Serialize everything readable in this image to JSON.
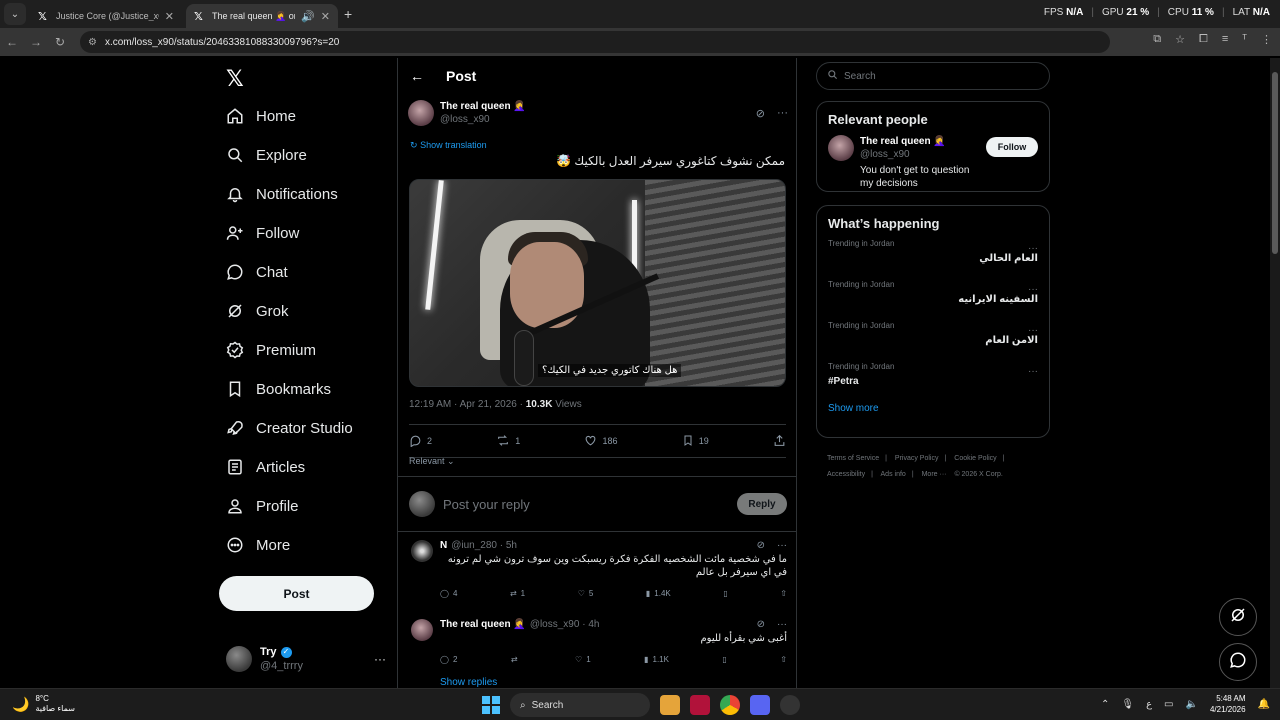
{
  "browser": {
    "tabs": [
      {
        "title": "Justice Core (@Justice_xCore) /",
        "active": false
      },
      {
        "title": "The real queen 🤦‍♀️ on X: \"مـ",
        "active": true
      }
    ],
    "url": "x.com/loss_x90/status/2046338108833009796?s=20",
    "perf": {
      "fps_label": "FPS",
      "fps": "N/A",
      "gpu_label": "GPU",
      "gpu": "21 %",
      "cpu_label": "CPU",
      "cpu": "11 %",
      "lat_label": "LAT",
      "lat": "N/A"
    }
  },
  "nav": {
    "logo": "𝕏",
    "items": [
      {
        "label": "Home",
        "icon": "home-icon"
      },
      {
        "label": "Explore",
        "icon": "search-icon"
      },
      {
        "label": "Notifications",
        "icon": "bell-icon"
      },
      {
        "label": "Follow",
        "icon": "person-plus-icon"
      },
      {
        "label": "Chat",
        "icon": "chat-icon"
      },
      {
        "label": "Grok",
        "icon": "grok-icon"
      },
      {
        "label": "Premium",
        "icon": "premium-icon"
      },
      {
        "label": "Bookmarks",
        "icon": "bookmark-icon"
      },
      {
        "label": "Creator Studio",
        "icon": "rocket-icon"
      },
      {
        "label": "Articles",
        "icon": "article-icon"
      },
      {
        "label": "Profile",
        "icon": "person-icon"
      },
      {
        "label": "More",
        "icon": "more-circle-icon"
      }
    ],
    "post_label": "Post",
    "account": {
      "name": "Try",
      "handle": "@4_trrry",
      "more": "···"
    }
  },
  "post": {
    "header": "Post",
    "author_name": "The real queen 🤦‍♀️",
    "author_handle": "@loss_x90",
    "show_translation": "Show translation",
    "text": "ممكن نشوف كتاغوري سيرفر العدل بالكيك 🤯",
    "subtitle": "هل هناك كاتوري جديد في الكيك؟",
    "time": "12:19 AM · Apr 21, 2026 · ",
    "views_count": "10.3K",
    "views_label": " Views",
    "replies": "2",
    "reposts": "1",
    "likes": "186",
    "bookmarks": "19",
    "relevant": "Relevant ⌄",
    "reply_placeholder": "Post your reply",
    "reply_button": "Reply"
  },
  "replies": [
    {
      "name": "N",
      "handle": "@iun_280 · 5h",
      "text": "ما في شخصية مائت الشخصيه الفكرة فكرة ريسبكت وين سوف ترون شي لم ترونه في اي سيرفر بل عالم",
      "replies": "4",
      "reposts": "1",
      "likes": "5",
      "views": "1.4K"
    },
    {
      "name": "The real queen 🤦‍♀️",
      "handle": "@loss_x90 · 4h",
      "text": "أغبى شي بقرأه لليوم",
      "replies": "2",
      "reposts": "",
      "likes": "1",
      "views": "1.1K"
    }
  ],
  "show_replies": "Show replies",
  "sidebar": {
    "search_placeholder": "Search",
    "relevant_title": "Relevant people",
    "person": {
      "name": "The real queen 🤦‍♀️",
      "handle": "@loss_x90",
      "bio": "You don't get to question my decisions",
      "follow": "Follow"
    },
    "happening_title": "What’s happening",
    "trends": [
      {
        "label": "Trending in Jordan",
        "name": "العام الحالي"
      },
      {
        "label": "Trending in Jordan",
        "name": "السفينه الايرانيه"
      },
      {
        "label": "Trending in Jordan",
        "name": "الامن العام"
      },
      {
        "label": "Trending in Jordan",
        "name": "#Petra"
      }
    ],
    "show_more": "Show more",
    "footer": [
      "Terms of Service",
      "|",
      "Privacy Policy",
      "|",
      "Cookie Policy",
      "|",
      "Accessibility",
      "|",
      "Ads info",
      "|",
      "More ···",
      "© 2026 X Corp."
    ]
  },
  "taskbar": {
    "temp": "8°C",
    "weather": "سماء صافية",
    "search": "Search",
    "lang": "ع",
    "time": "5:48 AM",
    "date": "4/21/2026"
  }
}
